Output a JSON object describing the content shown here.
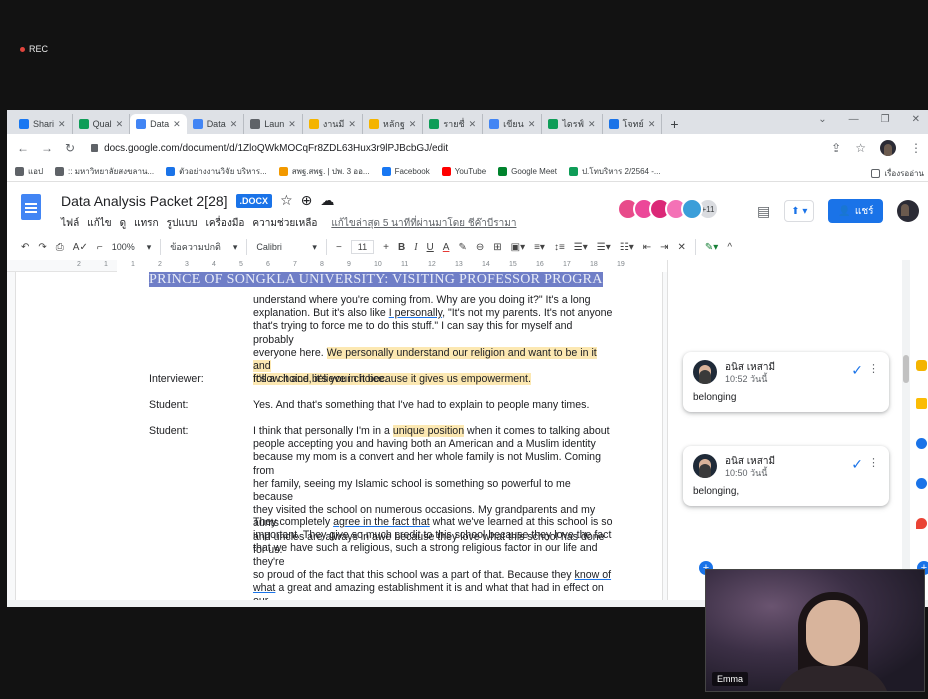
{
  "recording": {
    "label": "REC"
  },
  "tabs": [
    {
      "label": "Shari",
      "color": "#1877f2"
    },
    {
      "label": "Qual",
      "color": "#0f9d58"
    },
    {
      "label": "Data",
      "color": "#4285f4",
      "active": true
    },
    {
      "label": "Data",
      "color": "#4285f4"
    },
    {
      "label": "Laun",
      "color": "#5f6368"
    },
    {
      "label": "งานมี",
      "color": "#f4b400"
    },
    {
      "label": "หลักฐ",
      "color": "#f4b400"
    },
    {
      "label": "รายชื่",
      "color": "#0f9d58"
    },
    {
      "label": "เขียน",
      "color": "#4285f4"
    },
    {
      "label": "ไดรฟ์",
      "color": "#0f9d58"
    },
    {
      "label": "โจทย์",
      "color": "#1a73e8"
    }
  ],
  "address_bar": {
    "url": "docs.google.com/document/d/1ZloQWkMOCqFr8ZDL63Hux3r9lPJBcbGJ/edit"
  },
  "bookmarks": {
    "items": [
      "แอป",
      ":: มหาวิทยาลัยสงขลาน...",
      "ตัวอย่างงานวิจัย บริหาร...",
      "สพฐ.สพฐ. | ปพ. 3 ออ...",
      "Facebook",
      "YouTube",
      "Google Meet",
      "ป.โทบริหาร 2/2564 -..."
    ],
    "reading_list": "เรื่องรออ่าน"
  },
  "doc": {
    "title": "Data Analysis Packet 2[28]",
    "badge": ".DOCX",
    "menus": [
      "ไฟล์",
      "แก้ไข",
      "ดู",
      "แทรก",
      "รูปแบบ",
      "เครื่องมือ",
      "ความช่วยเหลือ"
    ],
    "last_edit": "แก้ไขล่าสุด 5 นาทีที่ผ่านมาโดย ชีค๊าบีรามา",
    "collab_count": "+11",
    "share_label": "แชร์"
  },
  "toolbar": {
    "zoom": "100%",
    "style": "ข้อความปกติ",
    "font": "Calibri",
    "size": "11"
  },
  "ruler_numbers": [
    "2",
    "1",
    "1",
    "2",
    "3",
    "4",
    "5",
    "6",
    "7",
    "8",
    "9",
    "10",
    "11",
    "12",
    "13",
    "14",
    "15",
    "16",
    "17",
    "18",
    "19"
  ],
  "document": {
    "banner": "PRINCE OF SONGKLA UNIVERSITY: VISITING PROFESSOR PROGRAM",
    "p1_lines": [
      "understand where you're coming from. Why are you doing it?\" It's a long",
      "explanation. But it's also like ",
      "I personally",
      ", \"It's not my parents. It's not anyone",
      "that's trying to force me to do this stuff.\" I can say this for myself and probably",
      "everyone here. ",
      "We personally understand our religion and want to be in it and",
      "follow it and believe in it because it gives us empowerment."
    ],
    "interviewer_label": "Interviewer:",
    "interviewer_text": "It's a choice, it's your choice.",
    "student_label_1": "Student:",
    "student_text_1": "Yes. And that's something that I've had to explain to people many times.",
    "student_label_2": "Student:",
    "p3": {
      "a": "I think that personally I'm in a ",
      "hl": "unique position",
      "b": " when it comes to talking about",
      "l2": "people accepting you and having both an American and a Muslim identity",
      "l3": "because my mom is a convert and her whole family is not Muslim. Coming from",
      "l4": "her family, seeing my Islamic school is something so powerful to me because",
      "l5": "they visited the school on numerous occasions. My grandparents and my aunts",
      "l6": "and uncles are always in awe because they love what this school has done for us."
    },
    "p4": {
      "a": "They completely ",
      "ul": "agree in the fact that",
      "b": " what we've learned at this school is so",
      "l2": "important. They give so much credit to this school because they love the fact",
      "l3": "that we have such a religious, such a strong religious factor in our life and they're",
      "l4a": "so proud of the fact that this school was a part of that. Because they ",
      "l4ul": "know of",
      "l5ul": "what",
      "l5b": " a great and amazing establishment it is and what that had in effect on our"
    }
  },
  "comments": [
    {
      "author": "อนิส เหสามี",
      "time": "10:52 วันนี้",
      "text": "belonging"
    },
    {
      "author": "อนิส เหสามี",
      "time": "10:50 วันนี้",
      "text": "belonging,"
    }
  ],
  "video": {
    "name": "Emma"
  }
}
